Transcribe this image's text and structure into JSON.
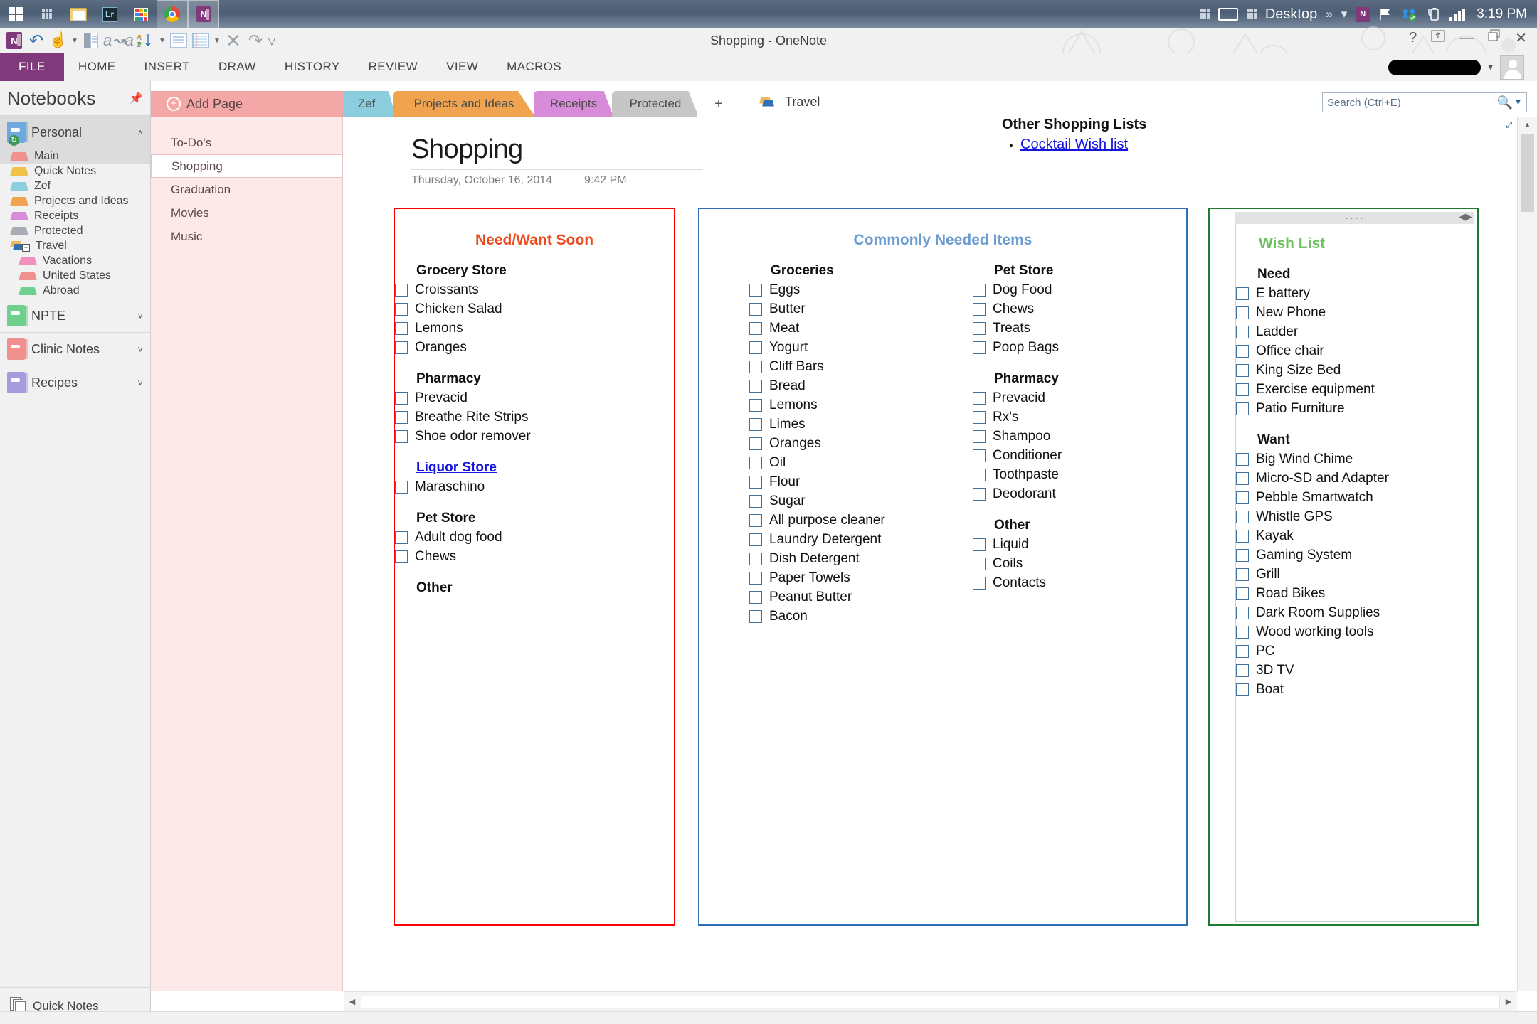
{
  "taskbar": {
    "apps": [
      {
        "name": "start-button",
        "icon": "windows-logo-icon"
      },
      {
        "name": "taskbar-dots-1",
        "icon": "dot-grid-icon"
      },
      {
        "name": "file-explorer",
        "icon": "folder-icon"
      },
      {
        "name": "lightroom",
        "icon": "lightroom-icon",
        "label": "Lr"
      },
      {
        "name": "app-launcher",
        "icon": "grid-apps-icon"
      },
      {
        "name": "chrome",
        "icon": "chrome-icon"
      },
      {
        "name": "onenote",
        "icon": "onenote-icon",
        "label": "N"
      }
    ],
    "tray": {
      "desktop_label": "Desktop",
      "overflow": "»",
      "clock": "3:19 PM"
    }
  },
  "window": {
    "title": "Shopping - OneNote",
    "controls": {
      "help": "?",
      "ribbon_display": "⤒",
      "minimize": "—",
      "restore": "❐",
      "close": "✕"
    }
  },
  "quick_access": {
    "items": [
      "onenote-icon",
      "undo-icon",
      "touch-mode-icon",
      "dropdown-icon",
      "dock-icon",
      "translate-icon",
      "sort-icon",
      "sort-dropdown-icon",
      "full-page-icon",
      "rule-lines-icon",
      "rule-dropdown-icon",
      "close-x-icon",
      "redo-icon",
      "customize-icon"
    ]
  },
  "ribbon": {
    "file_label": "FILE",
    "tabs": [
      "HOME",
      "INSERT",
      "DRAW",
      "HISTORY",
      "REVIEW",
      "VIEW",
      "MACROS"
    ]
  },
  "search": {
    "placeholder": "Search (Ctrl+E)",
    "value": ""
  },
  "sidebar": {
    "title": "Notebooks",
    "notebooks": [
      {
        "name": "Personal",
        "color": "#6fa8dc",
        "selected": true,
        "expanded": true,
        "chevron": "˄",
        "sections": [
          {
            "label": "Main",
            "color": "#f0908f",
            "selected": true,
            "sub": false
          },
          {
            "label": "Quick Notes",
            "color": "#f0c24a",
            "selected": false,
            "sub": false
          },
          {
            "label": "Zef",
            "color": "#8ccede",
            "selected": false,
            "sub": false
          },
          {
            "label": "Projects and Ideas",
            "color": "#f0a450",
            "selected": false,
            "sub": false
          },
          {
            "label": "Receipts",
            "color": "#d88bd8",
            "selected": false,
            "sub": false
          },
          {
            "label": "Protected",
            "color": "#a8adb5",
            "selected": false,
            "sub": false
          },
          {
            "label": "Travel",
            "color": "#2f6fb5",
            "selected": false,
            "sub": false,
            "group": true
          },
          {
            "label": "Vacations",
            "color": "#f090bc",
            "selected": false,
            "sub": true
          },
          {
            "label": "United States",
            "color": "#f0908f",
            "selected": false,
            "sub": true
          },
          {
            "label": "Abroad",
            "color": "#6fcf8f",
            "selected": false,
            "sub": true
          }
        ]
      },
      {
        "name": "NPTE",
        "color": "#6fcf8f",
        "selected": false,
        "expanded": false,
        "chevron": "˅",
        "sections": []
      },
      {
        "name": "Clinic Notes",
        "color": "#f0908f",
        "selected": false,
        "expanded": false,
        "chevron": "˅",
        "sections": []
      },
      {
        "name": "Recipes",
        "color": "#a59ce0",
        "selected": false,
        "expanded": false,
        "chevron": "˅",
        "sections": []
      }
    ],
    "bottom_label": "Quick Notes"
  },
  "section_tabs": [
    {
      "label": "Main",
      "color": "#f4a7a7",
      "active": true
    },
    {
      "label": "Quick Notes",
      "color": "#f0c24a",
      "active": false
    },
    {
      "label": "Zef",
      "color": "#8ccede",
      "active": false
    },
    {
      "label": "Projects and Ideas",
      "color": "#f0a450",
      "active": false
    },
    {
      "label": "Receipts",
      "color": "#d88bd8",
      "active": false
    },
    {
      "label": "Protected",
      "color": "#c6c6c6",
      "active": false
    },
    {
      "label": "+",
      "color": "#ffffff",
      "active": false
    }
  ],
  "travel_group": {
    "label": "Travel"
  },
  "page_list": {
    "add_page_label": "Add Page",
    "pages": [
      {
        "label": "To-Do's",
        "selected": false
      },
      {
        "label": "Shopping",
        "selected": true
      },
      {
        "label": "Graduation",
        "selected": false
      },
      {
        "label": "Movies",
        "selected": false
      },
      {
        "label": "Music",
        "selected": false
      }
    ]
  },
  "page": {
    "title": "Shopping",
    "date": "Thursday, October 16, 2014",
    "time": "9:42 PM",
    "other_lists": {
      "heading": "Other Shopping Lists",
      "links": [
        "Cocktail Wish list"
      ]
    }
  },
  "boxes": [
    {
      "id": "need-want-soon",
      "title": "Need/Want Soon",
      "title_color": "#ed4b1f",
      "border_color": "#ff0000",
      "columns": [
        {
          "groups": [
            {
              "heading": "Grocery Store",
              "link": false,
              "items": [
                "Croissants",
                "Chicken Salad",
                "Lemons",
                "Oranges"
              ]
            },
            {
              "heading": "Pharmacy",
              "link": false,
              "items": [
                "Prevacid",
                "Breathe Rite Strips",
                "Shoe odor remover"
              ]
            },
            {
              "heading": "Liquor Store",
              "link": true,
              "items": [
                "Maraschino"
              ]
            },
            {
              "heading": "Pet Store",
              "link": false,
              "items": [
                "Adult dog food",
                "Chews"
              ]
            },
            {
              "heading": "Other",
              "link": false,
              "items": []
            }
          ]
        }
      ]
    },
    {
      "id": "commonly-needed-items",
      "title": "Commonly Needed Items",
      "title_color": "#6a9bd1",
      "border_color": "#2f6fb5",
      "columns": [
        {
          "groups": [
            {
              "heading": "Groceries",
              "link": false,
              "items": [
                "Eggs",
                "Butter",
                "Meat",
                "Yogurt",
                "Cliff Bars",
                "Bread",
                "Lemons",
                "Limes",
                "Oranges",
                "Oil",
                "Flour",
                "Sugar",
                "All purpose cleaner",
                "Laundry Detergent",
                "Dish Detergent",
                "Paper Towels",
                "Peanut Butter",
                "Bacon"
              ]
            }
          ]
        },
        {
          "groups": [
            {
              "heading": "Pet Store",
              "link": false,
              "items": [
                "Dog Food",
                "Chews",
                "Treats",
                "Poop Bags"
              ]
            },
            {
              "heading": "Pharmacy",
              "link": false,
              "items": [
                "Prevacid",
                "Rx's",
                "Shampoo",
                "Conditioner",
                "Toothpaste",
                "Deodorant"
              ]
            },
            {
              "heading": "Other",
              "link": false,
              "items": [
                "Liquid",
                "Coils",
                "Contacts"
              ]
            }
          ]
        }
      ]
    },
    {
      "id": "wish-list",
      "title": "Wish List",
      "title_color": "#6fbf5f",
      "border_color": "#1e7a33",
      "handle_dots": "····",
      "handle_arrows": "◀▶",
      "columns": [
        {
          "groups": [
            {
              "heading": "Need",
              "link": false,
              "items": [
                "E battery",
                "New Phone",
                "Ladder",
                "Office chair",
                "King Size Bed",
                "Exercise equipment",
                "Patio Furniture"
              ]
            },
            {
              "heading": "Want",
              "link": false,
              "items": [
                "Big Wind Chime",
                "Micro-SD and Adapter",
                "Pebble Smartwatch",
                "Whistle GPS",
                "Kayak",
                "Gaming System",
                "Grill",
                "Road Bikes",
                "Dark Room Supplies",
                "Wood working tools",
                "PC",
                "3D TV",
                "Boat"
              ]
            }
          ]
        }
      ]
    }
  ]
}
